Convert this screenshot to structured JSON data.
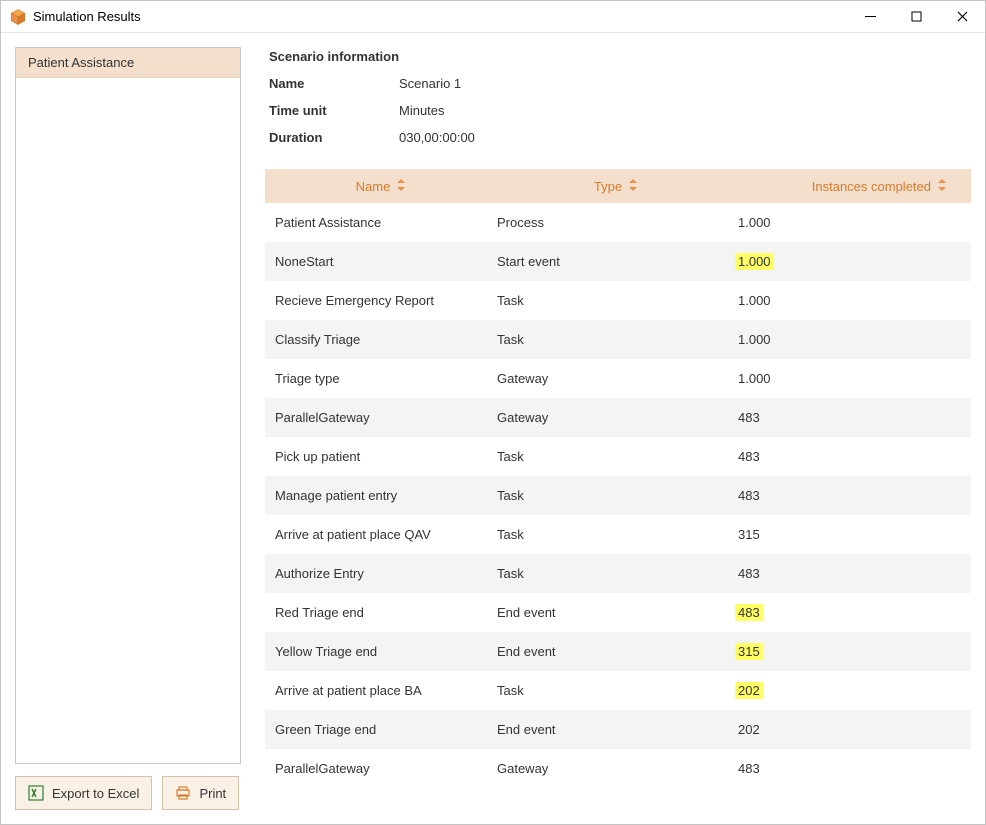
{
  "window": {
    "title": "Simulation Results"
  },
  "sidebar": {
    "selected": "Patient Assistance"
  },
  "buttons": {
    "export": "Export to Excel",
    "print": "Print"
  },
  "scenario": {
    "section_title": "Scenario information",
    "name_label": "Name",
    "name_value": "Scenario 1",
    "timeunit_label": "Time unit",
    "timeunit_value": "Minutes",
    "duration_label": "Duration",
    "duration_value": "030,00:00:00"
  },
  "grid": {
    "headers": {
      "name": "Name",
      "type": "Type",
      "instances": "Instances completed"
    },
    "rows": [
      {
        "name": "Patient Assistance",
        "type": "Process",
        "instances": "1.000",
        "highlight": false
      },
      {
        "name": "NoneStart",
        "type": "Start event",
        "instances": "1.000",
        "highlight": true
      },
      {
        "name": "Recieve Emergency Report",
        "type": "Task",
        "instances": "1.000",
        "highlight": false
      },
      {
        "name": "Classify Triage",
        "type": "Task",
        "instances": "1.000",
        "highlight": false
      },
      {
        "name": "Triage type",
        "type": "Gateway",
        "instances": "1.000",
        "highlight": false
      },
      {
        "name": "ParallelGateway",
        "type": "Gateway",
        "instances": "483",
        "highlight": false
      },
      {
        "name": "Pick up patient",
        "type": "Task",
        "instances": "483",
        "highlight": false
      },
      {
        "name": "Manage patient entry",
        "type": "Task",
        "instances": "483",
        "highlight": false
      },
      {
        "name": "Arrive at patient place QAV",
        "type": "Task",
        "instances": "315",
        "highlight": false
      },
      {
        "name": "Authorize Entry",
        "type": "Task",
        "instances": "483",
        "highlight": false
      },
      {
        "name": "Red Triage end",
        "type": "End event",
        "instances": "483",
        "highlight": true
      },
      {
        "name": "Yellow Triage end",
        "type": "End event",
        "instances": "315",
        "highlight": true
      },
      {
        "name": "Arrive at patient place BA",
        "type": "Task",
        "instances": "202",
        "highlight": true
      },
      {
        "name": "Green Triage end",
        "type": "End event",
        "instances": "202",
        "highlight": false
      },
      {
        "name": "ParallelGateway",
        "type": "Gateway",
        "instances": "483",
        "highlight": false
      }
    ]
  },
  "colors": {
    "accent": "#e8924e",
    "header_bg": "#f3dfcb",
    "highlight": "#ffff66"
  }
}
